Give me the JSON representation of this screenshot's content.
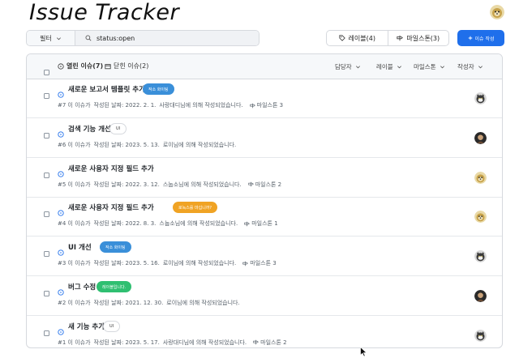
{
  "app": {
    "title": "Issue Tracker"
  },
  "toolbar": {
    "filter_label": "필터",
    "search_value": "status:open",
    "labels_button": "레이블(4)",
    "milestones_button": "마일스톤(3)",
    "new_issue_button": "이슈 작성"
  },
  "list_header": {
    "open_tab": "열린 이슈(7)",
    "closed_tab": "닫힌 이슈(2)",
    "filters": [
      "담당자",
      "레이블",
      "마일스톤",
      "작성자"
    ]
  },
  "issues": [
    {
      "title": "새로운 보고서 템플릿 추가",
      "label": "작소 화이팅",
      "label_bg": "#3a8fd9",
      "label_fg": "#ffffff",
      "number": "#7 이 이슈가",
      "written": "작성된 날짜: 2022. 2. 1.",
      "by": "사랑대디님에 의해 작성되었습니다.",
      "milestone": "마일스톤 3",
      "avatar": "cat"
    },
    {
      "title": "검색 기능 개선",
      "label": "UI",
      "label_bg": "#ffffff",
      "label_fg": "#333333",
      "number": "#6 이 이슈가",
      "written": "작성된 날짜: 2023. 5. 13.",
      "by": "로이님에 의해 작성되었습니다.",
      "milestone": "",
      "avatar": "dark"
    },
    {
      "title": "새로운 사용자 지정 필드 추가",
      "label": "",
      "label_bg": "",
      "label_fg": "",
      "number": "#5 이 이슈가",
      "written": "작성된 날짜: 2022. 3. 12.",
      "by": "스눕소님에 의해 작성되었습니다.",
      "milestone": "마일스톤 2",
      "avatar": "dog"
    },
    {
      "title": "새로운 사용자 지정 필드 추가",
      "label": "로녹스를 마십니까?",
      "label_bg": "#f0a324",
      "label_fg": "#ffffff",
      "number": "#4 이 이슈가",
      "written": "작성된 날짜: 2022. 8. 3.",
      "by": "스눕소님에 의해 작성되었습니다.",
      "milestone": "마일스톤 1",
      "avatar": "dog"
    },
    {
      "title": "UI 개선",
      "label": "작소 화이팅",
      "label_bg": "#3a8fd9",
      "label_fg": "#ffffff",
      "number": "#3 이 이슈가",
      "written": "작성된 날짜: 2023. 5. 16.",
      "by": "로이님에 의해 작성되었습니다.",
      "milestone": "마일스톤 3",
      "avatar": "cat"
    },
    {
      "title": "버그 수정",
      "label": "레이블입니다.",
      "label_bg": "#2fbf71",
      "label_fg": "#ffffff",
      "number": "#2 이 이슈가",
      "written": "작성된 날짜: 2021. 12. 30.",
      "by": "로이님에 의해 작성되었습니다.",
      "milestone": "",
      "avatar": "dark"
    },
    {
      "title": "새 기능 추가",
      "label": "UI",
      "label_bg": "#ffffff",
      "label_fg": "#333333",
      "number": "#1 이 이슈가",
      "written": "작성된 날짜: 2023. 5. 17.",
      "by": "사랑대디님에 의해 작성되었습니다.",
      "milestone": "마일스톤 2",
      "avatar": "cat"
    }
  ],
  "colors": {
    "primary": "#1f6feb",
    "open_icon": "#1f6feb",
    "border": "#d6d9de"
  }
}
